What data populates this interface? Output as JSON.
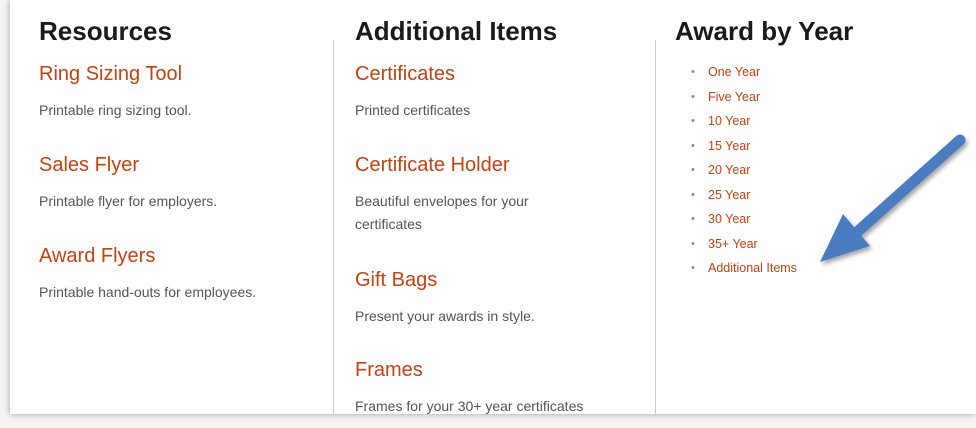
{
  "resources": {
    "heading": "Resources",
    "items": [
      {
        "title": "Ring Sizing Tool",
        "desc": "Printable ring sizing tool."
      },
      {
        "title": "Sales Flyer",
        "desc": "Printable flyer for employers."
      },
      {
        "title": "Award Flyers",
        "desc": "Printable hand-outs for employees."
      }
    ]
  },
  "additional": {
    "heading": "Additional Items",
    "items": [
      {
        "title": "Certificates",
        "desc": "Printed certificates"
      },
      {
        "title": "Certificate Holder",
        "desc": "Beautiful envelopes for your certificates"
      },
      {
        "title": "Gift Bags",
        "desc": "Present your awards in style."
      },
      {
        "title": "Frames",
        "desc": "Frames for your 30+ year certificates"
      }
    ]
  },
  "award_by_year": {
    "heading": "Award by Year",
    "links": [
      "One Year",
      "Five Year",
      "10 Year",
      "15 Year",
      "20 Year",
      "25 Year",
      "30 Year",
      "35+ Year",
      "Additional Items"
    ]
  },
  "colors": {
    "link": "#c8410f",
    "heading": "#1a1a1a",
    "arrow": "#4a7cc0"
  }
}
